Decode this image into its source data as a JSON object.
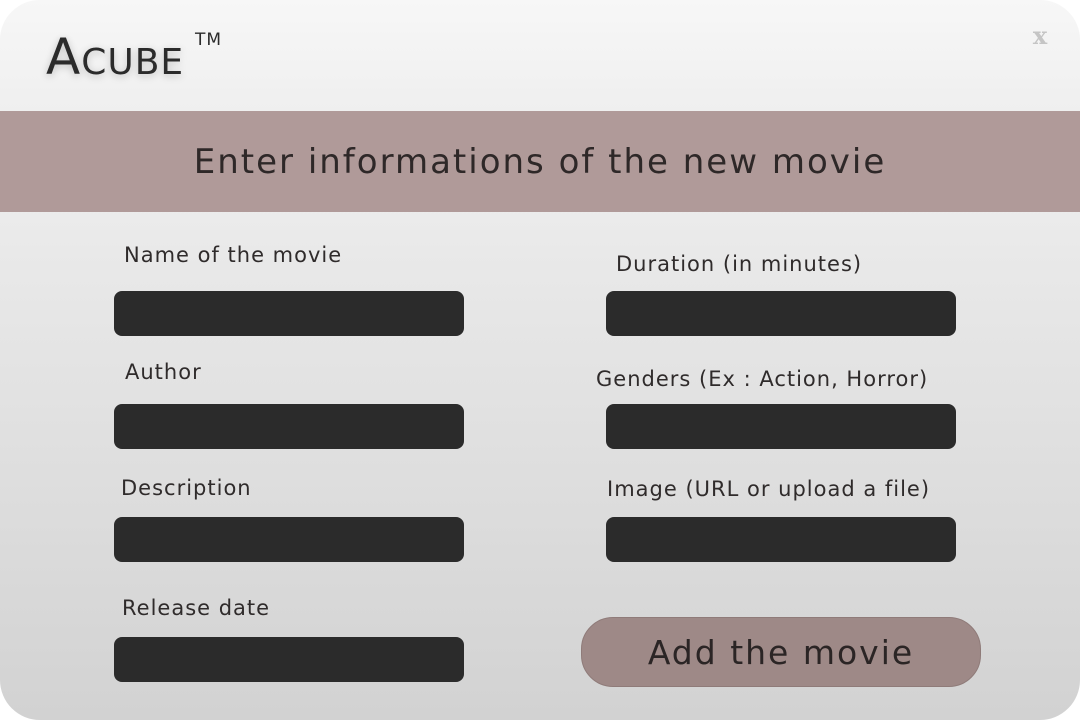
{
  "app": {
    "logo_first": "A",
    "logo_rest": "cube",
    "trademark": "TM",
    "close_label": "x"
  },
  "banner": {
    "title": "Enter informations of the new movie"
  },
  "form": {
    "name": {
      "label": "Name of the movie",
      "value": "",
      "placeholder": ""
    },
    "author": {
      "label": "Author",
      "value": "",
      "placeholder": ""
    },
    "description": {
      "label": "Description",
      "value": "",
      "placeholder": ""
    },
    "release_date": {
      "label": "Release date",
      "value": "",
      "placeholder": ""
    },
    "duration": {
      "label": "Duration (in minutes)",
      "value": "",
      "placeholder": ""
    },
    "genders": {
      "label": "Genders (Ex : Action, Horror)",
      "value": "",
      "placeholder": ""
    },
    "image": {
      "label": "Image (URL or upload a file)",
      "value": "",
      "placeholder": ""
    },
    "submit_label": "Add the movie"
  },
  "colors": {
    "banner": "#b09a99",
    "button": "#9e8987",
    "input": "#2b2b2b"
  }
}
